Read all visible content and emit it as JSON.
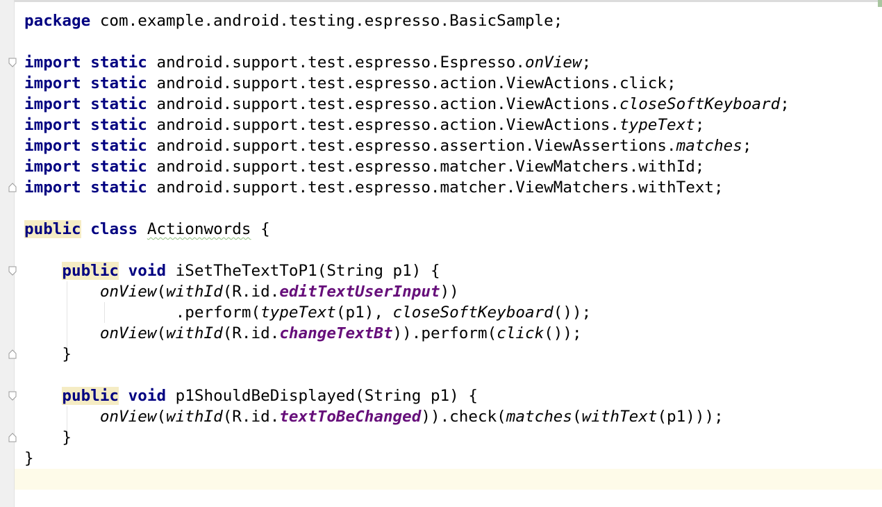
{
  "editor": {
    "lines": [
      {
        "tokens": [
          {
            "t": "package",
            "c": "kw"
          },
          {
            "t": " com.example.android.testing.espresso.BasicSample;"
          }
        ]
      },
      {
        "tokens": []
      },
      {
        "tokens": [
          {
            "t": "import",
            "c": "kw"
          },
          {
            "t": " "
          },
          {
            "t": "static",
            "c": "kw"
          },
          {
            "t": " android.support.test.espresso.Espresso."
          },
          {
            "t": "onView",
            "c": "it"
          },
          {
            "t": ";"
          }
        ]
      },
      {
        "tokens": [
          {
            "t": "import",
            "c": "kw"
          },
          {
            "t": " "
          },
          {
            "t": "static",
            "c": "kw"
          },
          {
            "t": " android.support.test.espresso.action.ViewActions.click;"
          }
        ]
      },
      {
        "tokens": [
          {
            "t": "import",
            "c": "kw"
          },
          {
            "t": " "
          },
          {
            "t": "static",
            "c": "kw"
          },
          {
            "t": " android.support.test.espresso.action.ViewActions."
          },
          {
            "t": "closeSoftKeyboard",
            "c": "it"
          },
          {
            "t": ";"
          }
        ]
      },
      {
        "tokens": [
          {
            "t": "import",
            "c": "kw"
          },
          {
            "t": " "
          },
          {
            "t": "static",
            "c": "kw"
          },
          {
            "t": " android.support.test.espresso.action.ViewActions."
          },
          {
            "t": "typeText",
            "c": "it"
          },
          {
            "t": ";"
          }
        ]
      },
      {
        "tokens": [
          {
            "t": "import",
            "c": "kw"
          },
          {
            "t": " "
          },
          {
            "t": "static",
            "c": "kw"
          },
          {
            "t": " android.support.test.espresso.assertion.ViewAssertions."
          },
          {
            "t": "matches",
            "c": "it"
          },
          {
            "t": ";"
          }
        ]
      },
      {
        "tokens": [
          {
            "t": "import",
            "c": "kw"
          },
          {
            "t": " "
          },
          {
            "t": "static",
            "c": "kw"
          },
          {
            "t": " android.support.test.espresso.matcher.ViewMatchers.withId;"
          }
        ]
      },
      {
        "tokens": [
          {
            "t": "import",
            "c": "kw"
          },
          {
            "t": " "
          },
          {
            "t": "static",
            "c": "kw"
          },
          {
            "t": " android.support.test.espresso.matcher.ViewMatchers.withText;"
          }
        ]
      },
      {
        "tokens": []
      },
      {
        "tokens": [
          {
            "t": "public",
            "c": "kw-hl"
          },
          {
            "t": " "
          },
          {
            "t": "class",
            "c": "kw"
          },
          {
            "t": " "
          },
          {
            "t": "Actionwords",
            "c": "squiggle"
          },
          {
            "t": " {"
          }
        ]
      },
      {
        "tokens": []
      },
      {
        "tokens": [
          {
            "t": "    "
          },
          {
            "t": "public",
            "c": "kw-hl"
          },
          {
            "t": " "
          },
          {
            "t": "void",
            "c": "kw"
          },
          {
            "t": " iSetTheTextToP1(String p1) {"
          }
        ]
      },
      {
        "tokens": [
          {
            "t": "        "
          },
          {
            "t": "onView",
            "c": "it"
          },
          {
            "t": "("
          },
          {
            "t": "withId",
            "c": "it"
          },
          {
            "t": "(R.id."
          },
          {
            "t": "editTextUserInput",
            "c": "field"
          },
          {
            "t": "))"
          }
        ]
      },
      {
        "tokens": [
          {
            "t": "                .perform("
          },
          {
            "t": "typeText",
            "c": "it"
          },
          {
            "t": "(p1), "
          },
          {
            "t": "closeSoftKeyboard",
            "c": "it"
          },
          {
            "t": "());"
          }
        ]
      },
      {
        "tokens": [
          {
            "t": "        "
          },
          {
            "t": "onView",
            "c": "it"
          },
          {
            "t": "("
          },
          {
            "t": "withId",
            "c": "it"
          },
          {
            "t": "(R.id."
          },
          {
            "t": "changeTextBt",
            "c": "field"
          },
          {
            "t": ")).perform("
          },
          {
            "t": "click",
            "c": "it"
          },
          {
            "t": "());"
          }
        ]
      },
      {
        "tokens": [
          {
            "t": "    }"
          }
        ]
      },
      {
        "tokens": []
      },
      {
        "tokens": [
          {
            "t": "    "
          },
          {
            "t": "public",
            "c": "kw-hl"
          },
          {
            "t": " "
          },
          {
            "t": "void",
            "c": "kw"
          },
          {
            "t": " p1ShouldBeDisplayed(String p1) {"
          }
        ]
      },
      {
        "tokens": [
          {
            "t": "        "
          },
          {
            "t": "onView",
            "c": "it"
          },
          {
            "t": "("
          },
          {
            "t": "withId",
            "c": "it"
          },
          {
            "t": "(R.id."
          },
          {
            "t": "textToBeChanged",
            "c": "field"
          },
          {
            "t": ")).check("
          },
          {
            "t": "matches",
            "c": "it"
          },
          {
            "t": "("
          },
          {
            "t": "withText",
            "c": "it"
          },
          {
            "t": "(p1)));"
          }
        ]
      },
      {
        "tokens": [
          {
            "t": "    }"
          }
        ]
      },
      {
        "tokens": [
          {
            "t": "}"
          }
        ]
      },
      {
        "tokens": []
      }
    ]
  },
  "colors": {
    "keyword": "#000080",
    "field": "#660e7a",
    "keyword_highlight": "#f5ecc4",
    "caret_line": "#fefbe9",
    "gutter": "#f0f0f0"
  }
}
